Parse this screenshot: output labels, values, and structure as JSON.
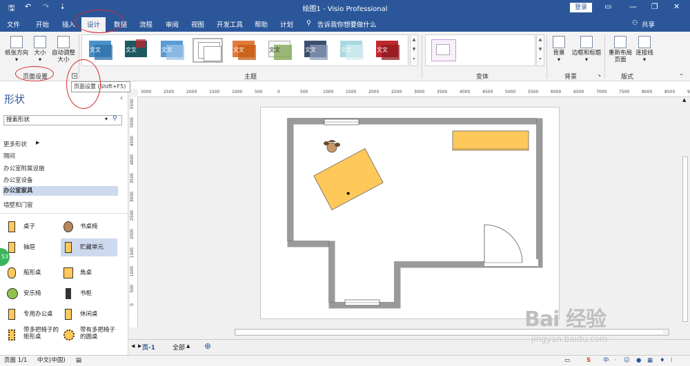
{
  "titlebar": {
    "title": "绘图1 - Visio Professional",
    "login": "登录",
    "qa_save": "🖫",
    "qa_undo": "↶",
    "qa_redo": "↷",
    "qa_more": "⇣"
  },
  "tabs": [
    "文件",
    "开始",
    "插入",
    "设计",
    "数据",
    "流程",
    "审阅",
    "视图",
    "开发工具",
    "帮助",
    "计划"
  ],
  "active_tab": "设计",
  "tellme": "告诉我你想要做什么",
  "share": "共享",
  "ribbon": {
    "orientation": "纸张方向",
    "size": "大小",
    "autofit_1": "自动调整",
    "autofit_2": "大小",
    "page_setup": "页面设置",
    "themes": "主题",
    "variants": "变体",
    "background": "背景",
    "borders_titles": "边框和标题",
    "background_group": "背景",
    "relayout_1": "重新布局",
    "relayout_2": "页面",
    "connectors": "连接线",
    "layout_group": "版式",
    "theme_text": "文文"
  },
  "tooltip": "页面设置 (Shift+F5)",
  "shapes_panel": {
    "title": "形状",
    "search_placeholder": "搜索形状",
    "more_shapes": "更多形状",
    "categories": [
      "隔间",
      "办公室附属设施",
      "办公室设备",
      "办公室家具",
      "墙壁和门窗"
    ],
    "selected_category": "办公室家具",
    "stencils": [
      {
        "label": "桌子"
      },
      {
        "label": "书桌椅"
      },
      {
        "label": "抽屉"
      },
      {
        "label": "贮藏单元"
      },
      {
        "label": "船形桌"
      },
      {
        "label": "角桌"
      },
      {
        "label": "安乐椅"
      },
      {
        "label": "书柜"
      },
      {
        "label": "专用办公桌"
      },
      {
        "label": "休闲桌"
      },
      {
        "label_1": "带多把椅子的",
        "label_2": "矩形桌"
      },
      {
        "label_1": "带有多把椅子",
        "label_2": "的圆桌"
      }
    ]
  },
  "ruler_h": [
    "3000",
    "2500",
    "2000",
    "1500",
    "1000",
    "500",
    "0",
    "500",
    "1000",
    "1500",
    "2000",
    "2500",
    "3000",
    "3500",
    "4000",
    "4500",
    "5000",
    "5500",
    "6000",
    "6500",
    "7000",
    "7500",
    "8000",
    "8500",
    "9000",
    "9500",
    "1000"
  ],
  "ruler_v": [
    "5500",
    "5000",
    "4500",
    "4000",
    "3500",
    "3000",
    "2500",
    "2000",
    "1500",
    "1000",
    "500",
    "0"
  ],
  "page_tabs": {
    "page1": "页-1",
    "all": "全部",
    "add": "⊕"
  },
  "status": {
    "page": "页面 1/1",
    "lang": "中文(中国)"
  },
  "badge": "53",
  "watermark": "Bai 经验",
  "watermark_url": "jingyan.baidu.com",
  "colors": {
    "accent": "#2b579a",
    "furniture": "#ffc85a",
    "wall": "#a8a8a8",
    "annotation": "#d9262a"
  }
}
